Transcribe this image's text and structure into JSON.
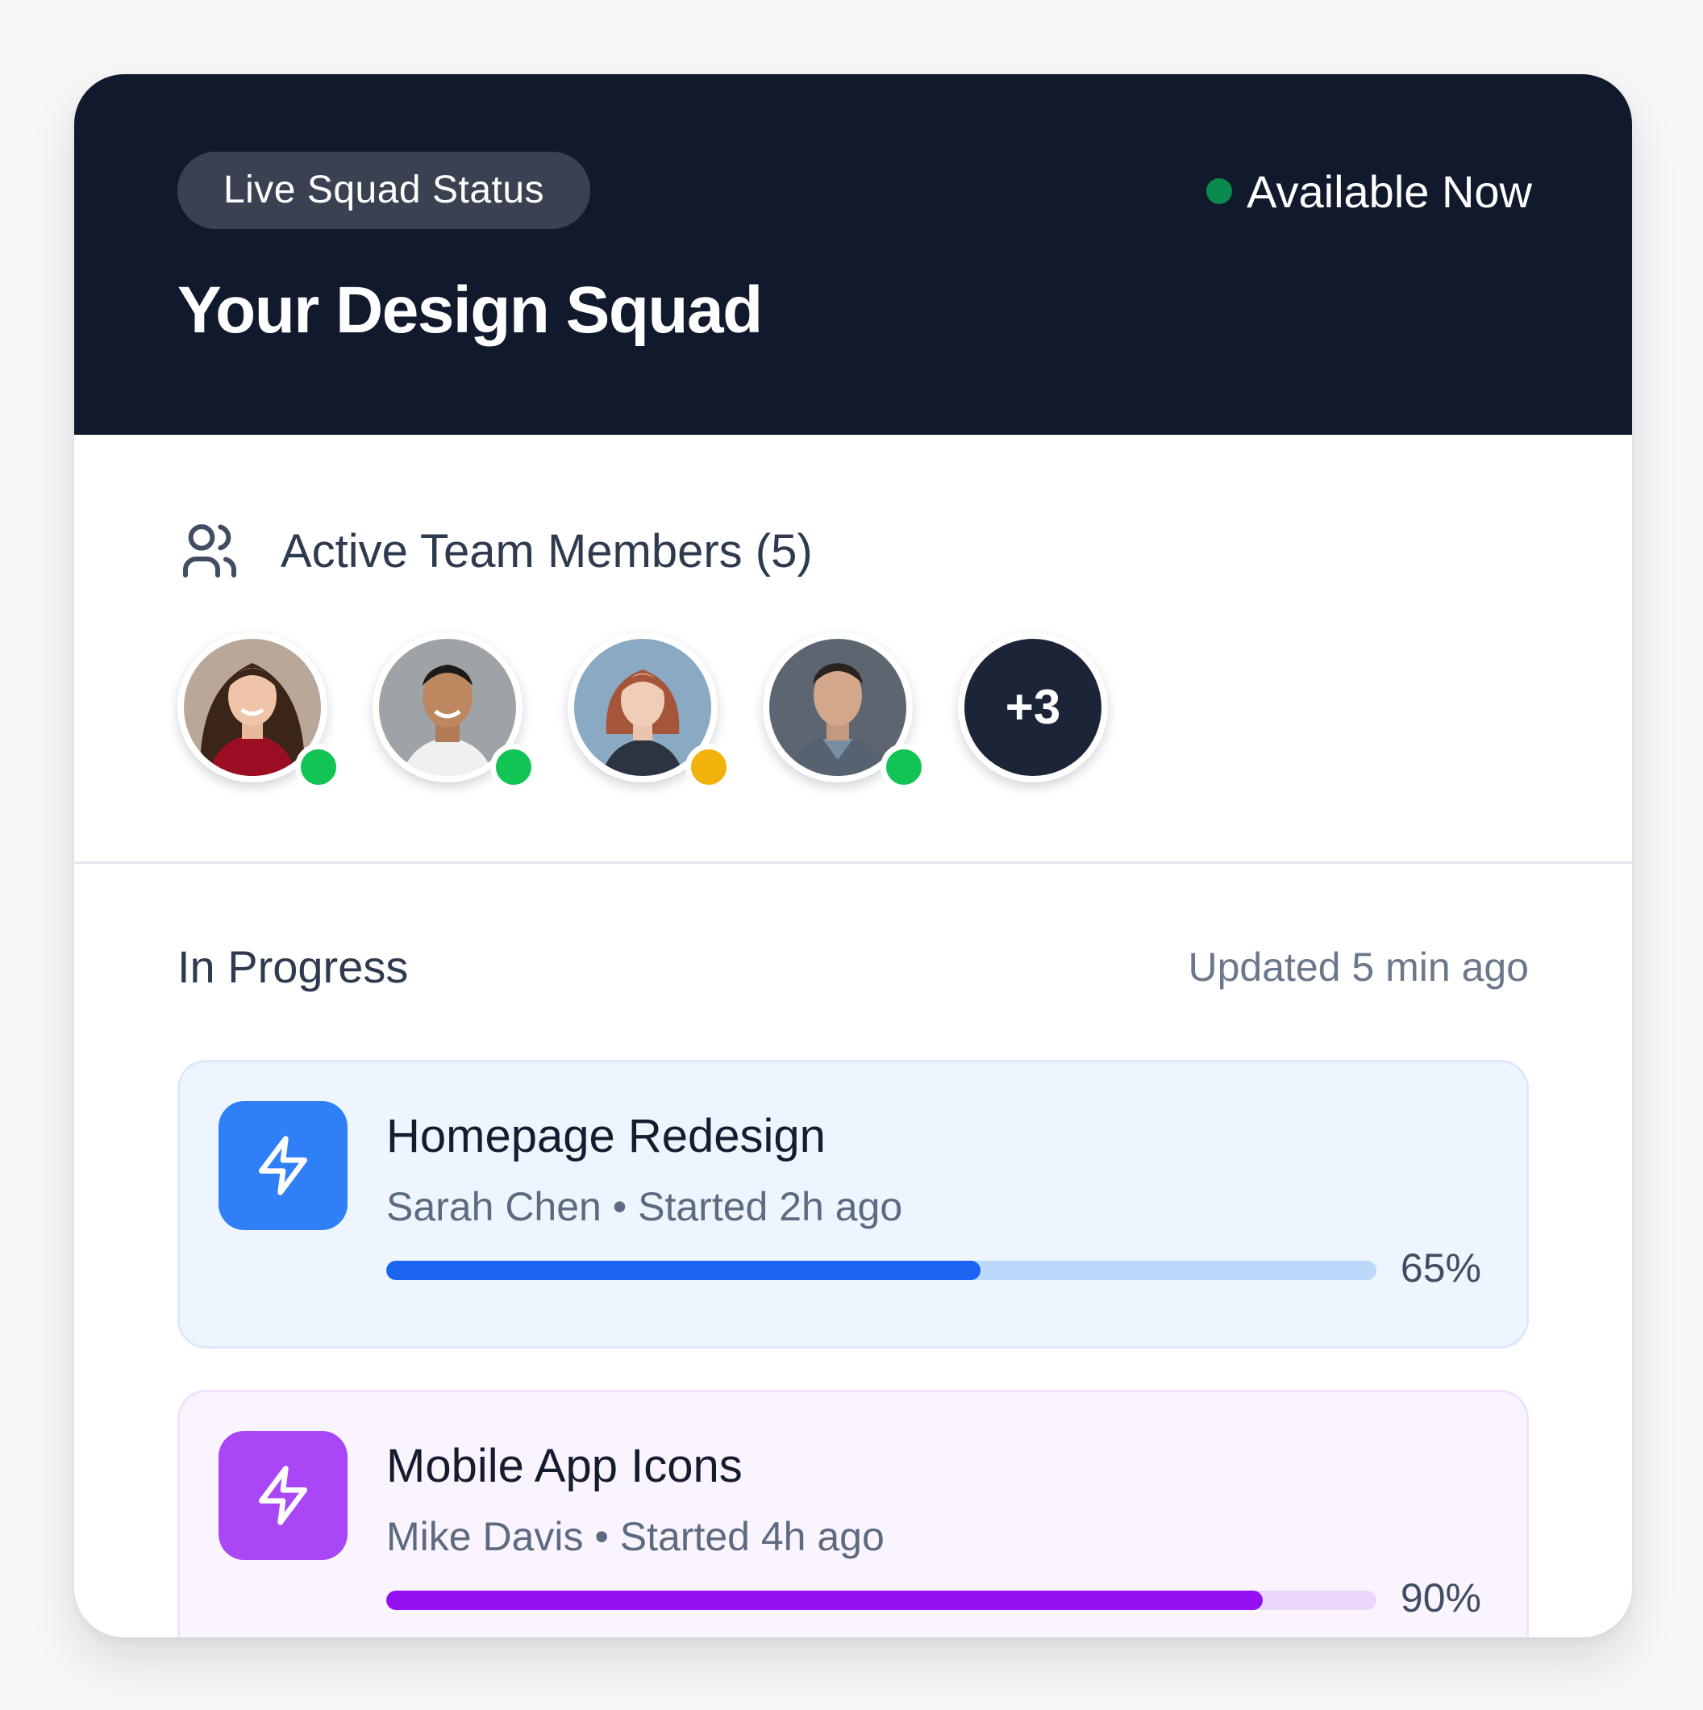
{
  "header": {
    "badge": "Live Squad Status",
    "availability": "Available Now",
    "availability_color": "#0b8a4e",
    "title": "Your Design Squad"
  },
  "members": {
    "icon": "users-icon",
    "label": "Active Team Members (5)",
    "avatars": [
      {
        "status": "online",
        "status_color": "#12c454"
      },
      {
        "status": "online",
        "status_color": "#12c454"
      },
      {
        "status": "away",
        "status_color": "#f2b20c"
      },
      {
        "status": "online",
        "status_color": "#12c454"
      }
    ],
    "more_label": "+3"
  },
  "progress": {
    "title": "In Progress",
    "updated": "Updated 5 min ago",
    "tasks": [
      {
        "name": "Homepage Redesign",
        "meta": "Sarah Chen • Started 2h ago",
        "percent_label": "65%",
        "progress": 0.6,
        "icon": "lightning-icon",
        "accent": "#2f80f7"
      },
      {
        "name": "Mobile App Icons",
        "meta": "Mike Davis • Started 4h ago",
        "percent_label": "90%",
        "progress": 0.885,
        "icon": "lightning-icon",
        "accent": "#a946f5"
      }
    ]
  }
}
